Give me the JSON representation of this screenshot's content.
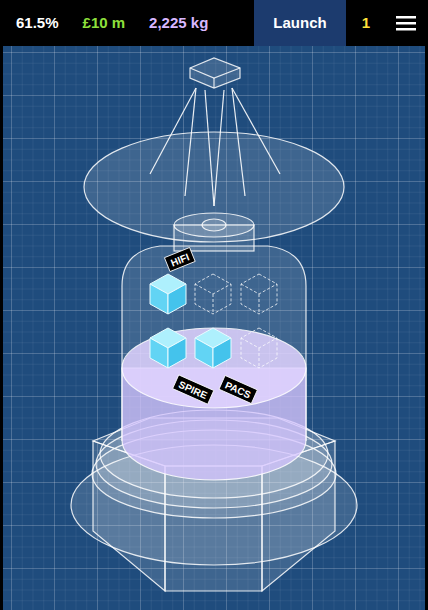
{
  "status_bar": {
    "progress": "61.5%",
    "budget": "£10 m",
    "mass": "2,225 kg",
    "launch_button": "Launch",
    "launches": "1"
  },
  "slots": [
    {
      "label": "HIFI",
      "filled": true
    },
    {
      "filled": false
    },
    {
      "filled": false
    },
    {
      "label": "SPIRE",
      "filled": true
    },
    {
      "label": "PACS",
      "filled": true
    },
    {
      "filled": false
    }
  ]
}
